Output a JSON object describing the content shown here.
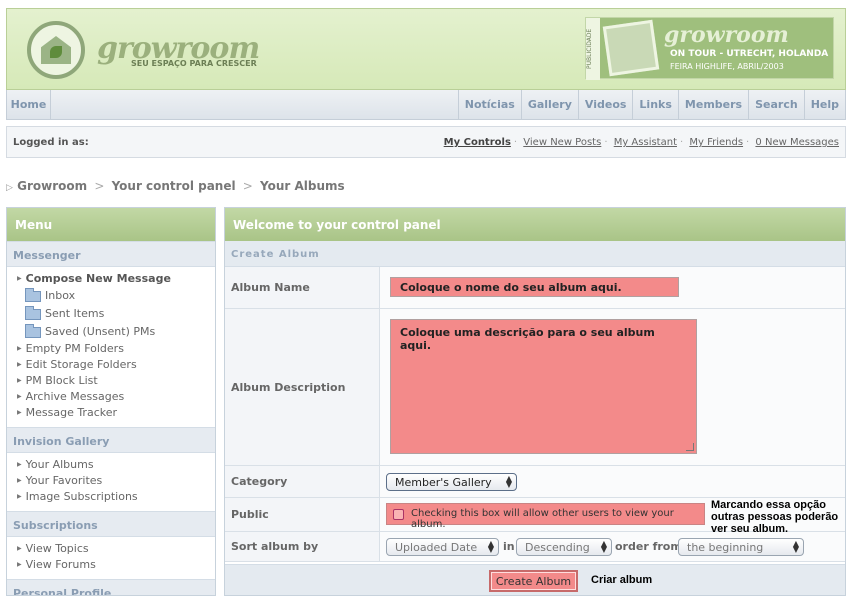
{
  "header": {
    "logo_word": "growroom",
    "logo_tagline": "SEU ESPAÇO PARA CRESCER",
    "ad": {
      "side_text": "PUBLICIDADE",
      "word": "growroom",
      "line1": "ON TOUR - UTRECHT, HOLANDA",
      "line2": "FEIRA HIGHLIFE, ABRIL/2003"
    }
  },
  "nav": {
    "home": "Home",
    "links": [
      "Notícias",
      "Gallery",
      "Videos",
      "Links",
      "Members",
      "Search",
      "Help"
    ]
  },
  "userbar": {
    "logged_in": "Logged in as:",
    "links": [
      "My Controls",
      "View New Posts",
      "My Assistant",
      "My Friends",
      "0 New Messages"
    ]
  },
  "breadcrumb": [
    "Growroom",
    "Your control panel",
    "Your Albums"
  ],
  "sidebar": {
    "title": "Menu",
    "sections": [
      {
        "title": "Messenger",
        "items": [
          "Compose New Message",
          "Inbox",
          "Sent Items",
          "Saved (Unsent) PMs",
          "Empty PM Folders",
          "Edit Storage Folders",
          "PM Block List",
          "Archive Messages",
          "Message Tracker"
        ]
      },
      {
        "title": "Invision Gallery",
        "items": [
          "Your Albums",
          "Your Favorites",
          "Image Subscriptions"
        ]
      },
      {
        "title": "Subscriptions",
        "items": [
          "View Topics",
          "View Forums"
        ]
      },
      {
        "title": "Personal Profile",
        "items": []
      }
    ]
  },
  "main": {
    "title": "Welcome to your control panel",
    "subtitle": "Create Album",
    "album_name_label": "Album Name",
    "album_name_value": "Coloque o nome do seu album aqui.",
    "album_desc_label": "Album Description",
    "album_desc_value": "Coloque uma descrição para o seu album aqui.",
    "category_label": "Category",
    "category_value": "Member's Gallery",
    "public_label": "Public",
    "public_text": "Checking this box will allow other users to view your album.",
    "public_annotation": "Marcando essa opção outras pessoas poderão ver seu album.",
    "sort_label": "Sort album by",
    "sort_field": "Uploaded Date",
    "sort_in": "in",
    "sort_order": "Descending",
    "order_from": "order from",
    "order_from_value": "the beginning",
    "submit_label": "Create Album",
    "submit_annotation": "Criar album"
  },
  "colors": {
    "header_green": "#d6e9b8",
    "panel_head_green": "#a9c487",
    "highlight_red": "#f38a8a",
    "nav_text": "#7f95ad"
  }
}
